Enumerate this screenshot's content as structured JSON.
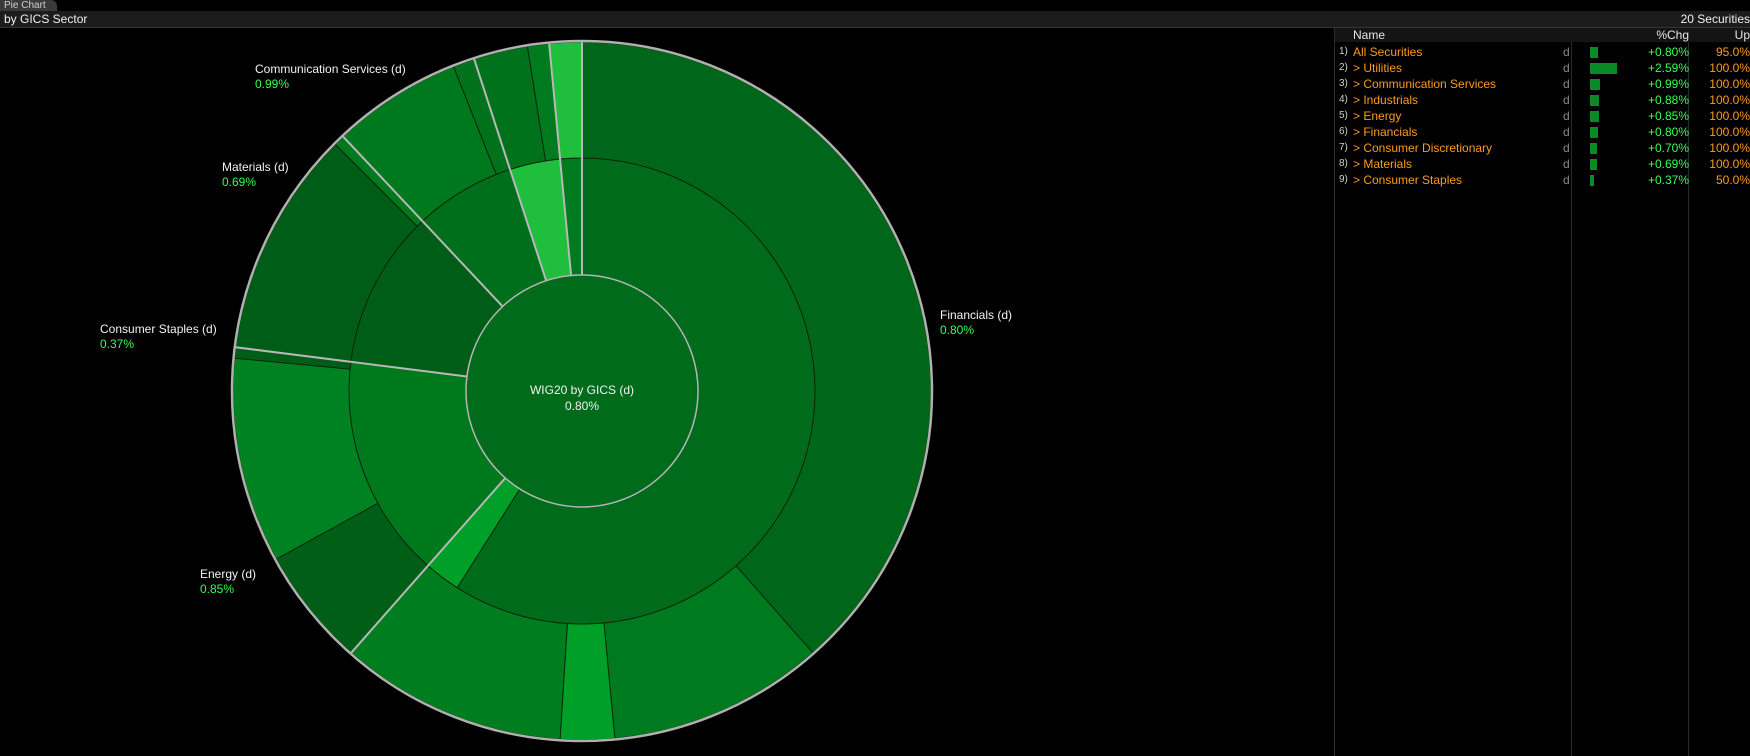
{
  "window": {
    "tab_title": "Pie Chart"
  },
  "header": {
    "grouping": "by GICS Sector",
    "securities_count": "20 Securities"
  },
  "colors": {
    "accent_orange": "#ff9a1c",
    "positive_green": "#33ff55",
    "bar_green": "#0a8a26"
  },
  "chart": {
    "center_title": "WIG20 by GICS (d)",
    "center_value": "0.80%",
    "labels": [
      {
        "name": "Financials (d)",
        "value": "0.80%"
      },
      {
        "name": "Communication Services (d)",
        "value": "0.99%"
      },
      {
        "name": "Materials (d)",
        "value": "0.69%"
      },
      {
        "name": "Consumer Staples (d)",
        "value": "0.37%"
      },
      {
        "name": "Energy (d)",
        "value": "0.85%"
      }
    ]
  },
  "chart_data": {
    "type": "pie",
    "title": "WIG20 by GICS (d)",
    "center_value": "0.80%",
    "categories": [
      "Financials",
      "Energy",
      "Consumer Staples",
      "Materials",
      "Communication Services",
      "Utilities"
    ],
    "inner_ring": [
      {
        "sector": "Financials",
        "share_pct": 59.0,
        "color": "#006b1b"
      },
      {
        "sector": "Financials",
        "share_pct": 2.5,
        "color": "#009f27"
      },
      {
        "sector": "Energy",
        "share_pct": 15.5,
        "color": "#00791d"
      },
      {
        "sector": "Consumer Staples",
        "share_pct": 11.0,
        "color": "#005d17"
      },
      {
        "sector": "Materials",
        "share_pct": 7.0,
        "color": "#006f1b"
      },
      {
        "sector": "Communication Services",
        "share_pct": 3.5,
        "color": "#1fbe3d"
      },
      {
        "sector": "Utilities",
        "share_pct": 1.5,
        "color": "#007a1e"
      }
    ],
    "outer_ring": [
      {
        "share_pct": 38.5,
        "color": "#006619"
      },
      {
        "share_pct": 10.0,
        "color": "#007a1e"
      },
      {
        "share_pct": 2.5,
        "color": "#00a028"
      },
      {
        "share_pct": 10.5,
        "color": "#007e1f"
      },
      {
        "share_pct": 5.5,
        "color": "#005e17"
      },
      {
        "share_pct": 9.5,
        "color": "#008223"
      },
      {
        "share_pct": 11.0,
        "color": "#005d17"
      },
      {
        "share_pct": 6.5,
        "color": "#00781d"
      },
      {
        "share_pct": 3.5,
        "color": "#00721c"
      },
      {
        "share_pct": 1.0,
        "color": "#007a1e"
      },
      {
        "share_pct": 1.5,
        "color": "#1fbe3d"
      }
    ]
  },
  "table": {
    "headers": {
      "name": "Name",
      "chg": "%Chg",
      "up": "Up"
    },
    "rows": [
      {
        "num": "1)",
        "name": "All Securities",
        "flag": "d",
        "chg": "+0.80%",
        "chg_value": 0.8,
        "up": "95.0%"
      },
      {
        "num": "2)",
        "name": "> Utilities",
        "flag": "d",
        "chg": "+2.59%",
        "chg_value": 2.59,
        "up": "100.0%"
      },
      {
        "num": "3)",
        "name": "> Communication Services",
        "flag": "d",
        "chg": "+0.99%",
        "chg_value": 0.99,
        "up": "100.0%"
      },
      {
        "num": "4)",
        "name": "> Industrials",
        "flag": "d",
        "chg": "+0.88%",
        "chg_value": 0.88,
        "up": "100.0%"
      },
      {
        "num": "5)",
        "name": "> Energy",
        "flag": "d",
        "chg": "+0.85%",
        "chg_value": 0.85,
        "up": "100.0%"
      },
      {
        "num": "6)",
        "name": "> Financials",
        "flag": "d",
        "chg": "+0.80%",
        "chg_value": 0.8,
        "up": "100.0%"
      },
      {
        "num": "7)",
        "name": "> Consumer Discretionary",
        "flag": "d",
        "chg": "+0.70%",
        "chg_value": 0.7,
        "up": "100.0%"
      },
      {
        "num": "8)",
        "name": "> Materials",
        "flag": "d",
        "chg": "+0.69%",
        "chg_value": 0.69,
        "up": "100.0%"
      },
      {
        "num": "9)",
        "name": "> Consumer Staples",
        "flag": "d",
        "chg": "+0.37%",
        "chg_value": 0.37,
        "up": "50.0%"
      }
    ]
  }
}
